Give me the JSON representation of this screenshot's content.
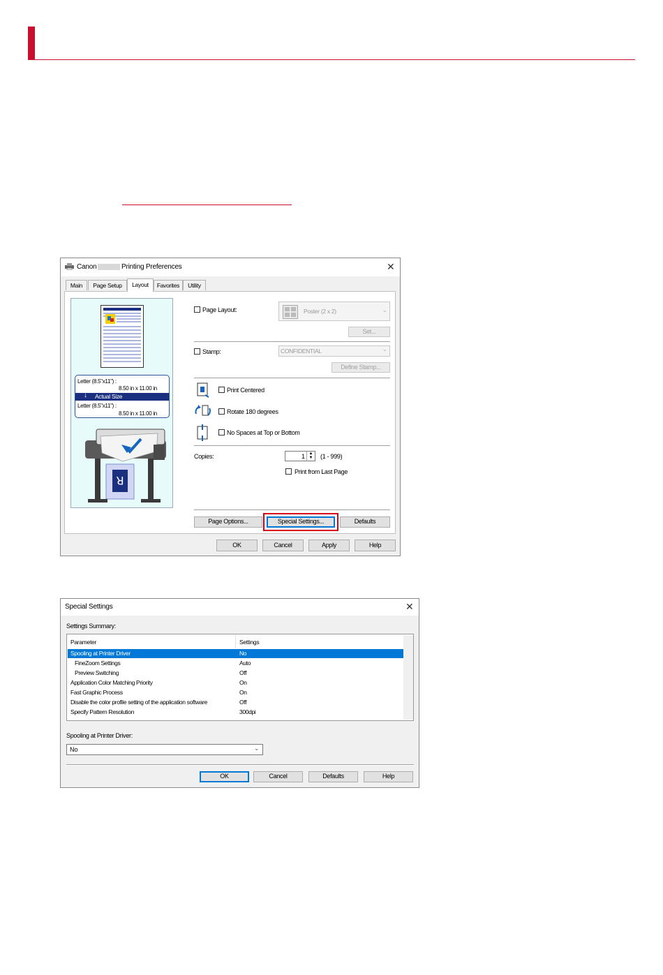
{
  "layout_dialog": {
    "title_prefix": "Canon",
    "title_suffix": "Printing Preferences",
    "tabs": [
      {
        "label": "Main"
      },
      {
        "label": "Page Setup"
      },
      {
        "label": "Layout"
      },
      {
        "label": "Favorites"
      },
      {
        "label": "Utility"
      }
    ],
    "active_tab": "Layout",
    "preview": {
      "source_size": "Letter (8.5\"x11\") :",
      "source_dims": "8.50 in x 11.00 in",
      "mode": "Actual Size",
      "output_size": "Letter (8.5\"x11\") :",
      "output_dims": "8.50 in x 11.00 in"
    },
    "page_layout_label": "Page Layout:",
    "page_layout_value": "Poster (2 x 2)",
    "set_button": "Set...",
    "stamp_label": "Stamp:",
    "stamp_value": "CONFIDENTIAL",
    "define_stamp_button": "Define Stamp...",
    "print_centered_label": "Print Centered",
    "rotate_label": "Rotate 180 degrees",
    "no_spaces_label": "No Spaces at Top or Bottom",
    "copies_label": "Copies:",
    "copies_value": "1",
    "copies_range": "(1 - 999)",
    "print_from_last_label": "Print from Last Page",
    "page_options_button": "Page Options...",
    "special_settings_button": "Special Settings...",
    "defaults_button": "Defaults",
    "ok_button": "OK",
    "cancel_button": "Cancel",
    "apply_button": "Apply",
    "help_button": "Help"
  },
  "special_dialog": {
    "title": "Special Settings",
    "summary_label": "Settings Summary:",
    "columns": [
      "Parameter",
      "Settings"
    ],
    "rows": [
      {
        "param": "Spooling at Printer Driver",
        "value": "No",
        "indent": false,
        "selected": true
      },
      {
        "param": "FineZoom Settings",
        "value": "Auto",
        "indent": true,
        "selected": false
      },
      {
        "param": "Preview Switching",
        "value": "Off",
        "indent": true,
        "selected": false
      },
      {
        "param": "Application Color Matching Priority",
        "value": "On",
        "indent": false,
        "selected": false
      },
      {
        "param": "Fast Graphic Process",
        "value": "On",
        "indent": false,
        "selected": false
      },
      {
        "param": "Disable the color profile setting of the application software",
        "value": "Off",
        "indent": false,
        "selected": false
      },
      {
        "param": "Specify Pattern Resolution",
        "value": "300dpi",
        "indent": false,
        "selected": false
      }
    ],
    "field_label": "Spooling at Printer Driver:",
    "field_value": "No",
    "ok_button": "OK",
    "cancel_button": "Cancel",
    "defaults_button": "Defaults",
    "help_button": "Help"
  },
  "colors": {
    "accent_red": "#c8102e",
    "selection_blue": "#0078d7",
    "highlight_box": "#d6001c"
  }
}
